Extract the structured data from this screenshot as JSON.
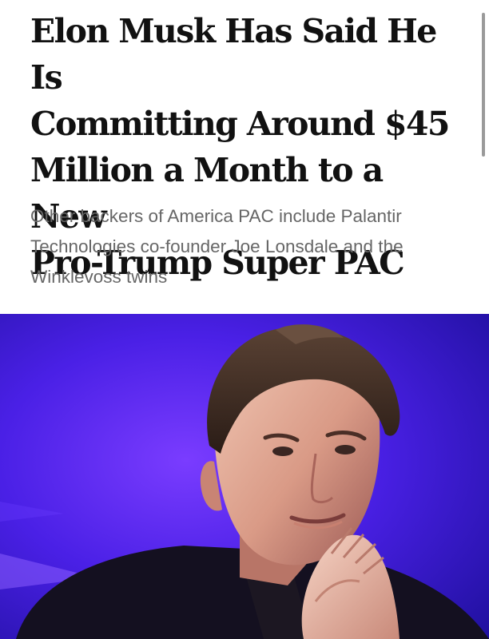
{
  "article": {
    "headline_lines": [
      "Elon Musk Has Said He Is",
      "Committing Around $45",
      "Million a Month to a New",
      "Pro-Trump Super PAC"
    ],
    "dek_lines": [
      "Other backers of America PAC include Palantir",
      "Technologies co-founder Joe Lonsdale and the",
      "Winklevoss twins"
    ]
  },
  "hero_image": {
    "subject": "man-with-hands-pressed-together",
    "background_color": "#3a18d8",
    "accent_color": "#6a35ff"
  },
  "colors": {
    "headline": "#111111",
    "dek": "#666666",
    "background": "#ffffff"
  }
}
